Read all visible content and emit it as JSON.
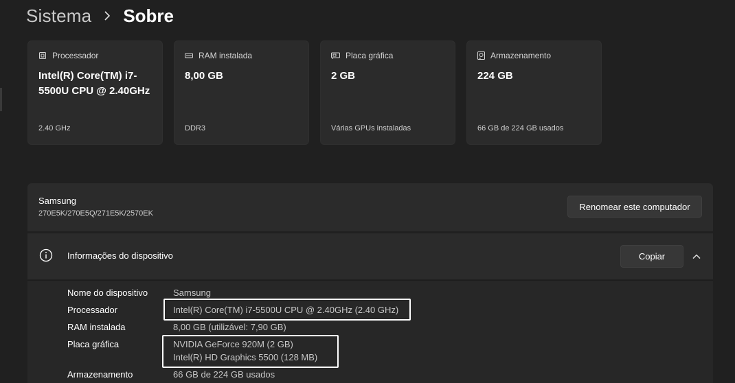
{
  "breadcrumb": {
    "parent": "Sistema",
    "current": "Sobre"
  },
  "cards": [
    {
      "icon": "processor-icon",
      "title": "Processador",
      "value": "Intel(R) Core(TM) i7-5500U CPU @ 2.40GHz",
      "sub": "2.40 GHz"
    },
    {
      "icon": "ram-icon",
      "title": "RAM instalada",
      "value": "8,00 GB",
      "sub": "DDR3"
    },
    {
      "icon": "graphics-card-icon",
      "title": "Placa gráfica",
      "value": "2 GB",
      "sub": "Várias GPUs instaladas"
    },
    {
      "icon": "storage-icon",
      "title": "Armazenamento",
      "value": "224 GB",
      "sub": "66 GB de 224 GB usados"
    }
  ],
  "device": {
    "name": "Samsung",
    "model": "270E5K/270E5Q/271E5K/2570EK",
    "rename_label": "Renomear este computador"
  },
  "info": {
    "title": "Informações do dispositivo",
    "copy_label": "Copiar",
    "rows": [
      {
        "label": "Nome do dispositivo",
        "value": "Samsung"
      },
      {
        "label": "Processador",
        "value": "Intel(R) Core(TM) i7-5500U CPU @ 2.40GHz (2.40 GHz)"
      },
      {
        "label": "RAM instalada",
        "value": "8,00 GB (utilizável: 7,90 GB)"
      },
      {
        "label": "Placa gráfica",
        "value": "NVIDIA GeForce 920M (2 GB)",
        "value2": "Intel(R) HD Graphics 5500 (128 MB)"
      },
      {
        "label": "Armazenamento",
        "value": "66 GB de 224 GB usados"
      }
    ]
  },
  "colors": {
    "background": "#202020",
    "card": "#2b2b2b",
    "highlight_box": "#ffffff"
  }
}
